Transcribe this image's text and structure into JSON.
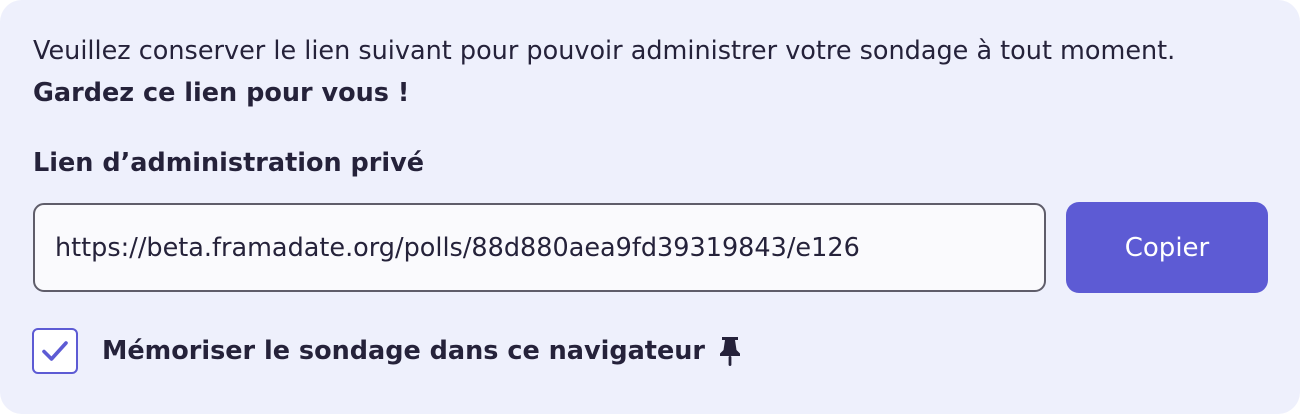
{
  "notice": {
    "text": "Veuillez conserver le lien suivant pour pouvoir administrer votre sondage à tout moment.",
    "emphasis": "Gardez ce lien pour vous !"
  },
  "admin_link": {
    "label": "Lien d’administration privé",
    "value": "https://beta.framadate.org/polls/88d880aea9fd39319843/e126"
  },
  "copy_button": {
    "label": "Copier"
  },
  "remember": {
    "checked": true,
    "label": "Mémoriser le sondage dans ce navigateur",
    "icon": "pin-icon"
  },
  "colors": {
    "panel_background": "#eef0fc",
    "accent": "#5d5bd4",
    "text": "#25223a"
  }
}
